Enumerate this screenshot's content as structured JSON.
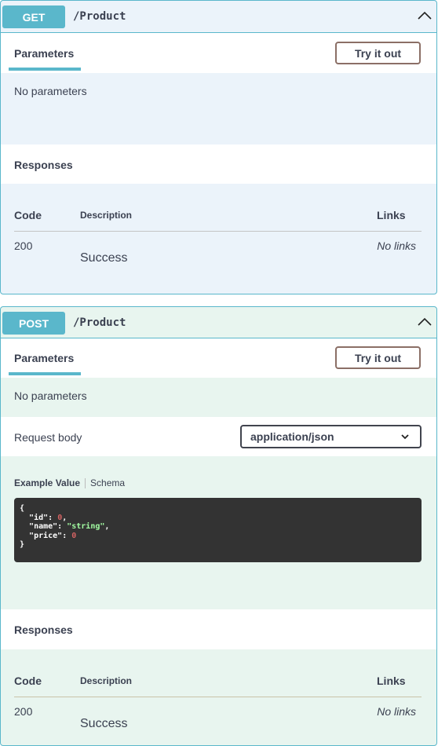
{
  "operations": [
    {
      "method": "GET",
      "path": "/Product",
      "parameters_tab": "Parameters",
      "try_button": "Try it out",
      "no_params": "No parameters",
      "responses_title": "Responses",
      "table": {
        "headers": [
          "Code",
          "Description",
          "Links"
        ],
        "rows": [
          {
            "code": "200",
            "description": "Success",
            "links": "No links"
          }
        ]
      }
    },
    {
      "method": "POST",
      "path": "/Product",
      "parameters_tab": "Parameters",
      "try_button": "Try it out",
      "no_params": "No parameters",
      "request_body_label": "Request body",
      "content_type": "application/json",
      "example_tab": "Example Value",
      "schema_tab": "Schema",
      "example": {
        "open": "{",
        "k1": "\"id\"",
        "v1": "0",
        "k2": "\"name\"",
        "v2": "\"string\"",
        "k3": "\"price\"",
        "v3": "0",
        "close": "}"
      },
      "responses_title": "Responses",
      "table": {
        "headers": [
          "Code",
          "Description",
          "Links"
        ],
        "rows": [
          {
            "code": "200",
            "description": "Success",
            "links": "No links"
          }
        ]
      }
    }
  ],
  "colors": {
    "accent": "#5ab7cb",
    "get_bg": "#ebf3fa",
    "post_bg": "#e8f5ef"
  }
}
